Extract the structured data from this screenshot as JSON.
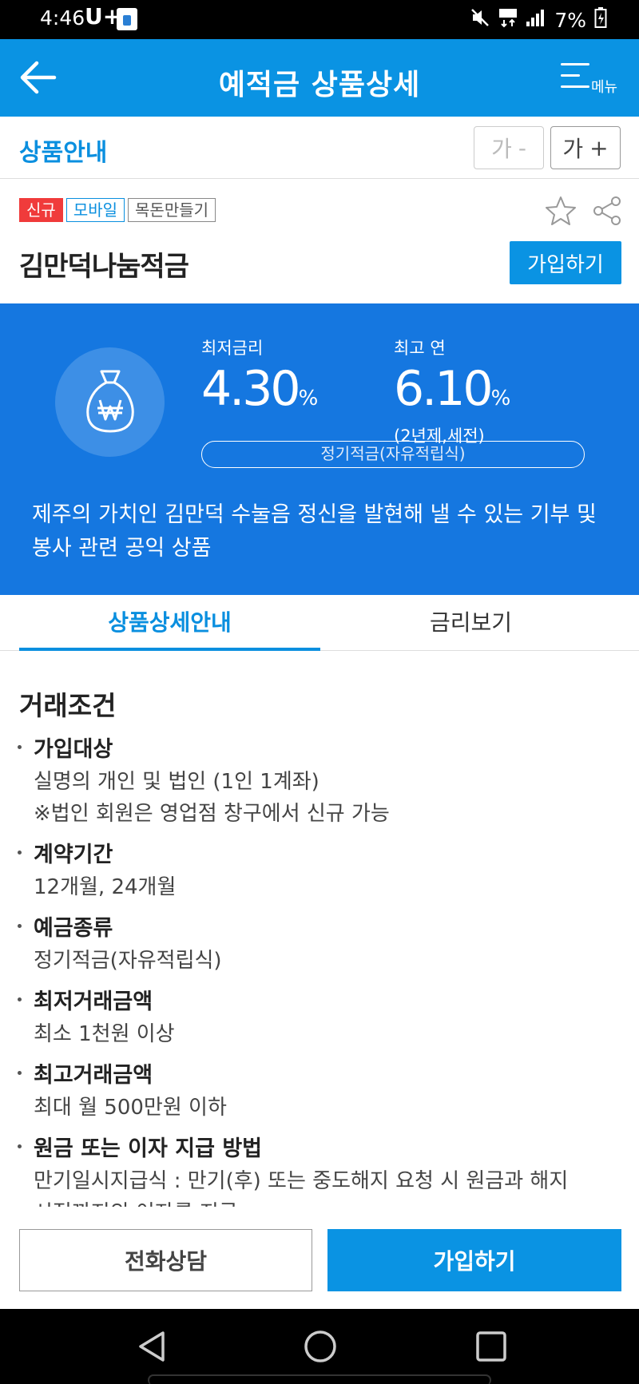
{
  "status_bar": {
    "time": "4:46",
    "carrier": "U+",
    "battery": "7%"
  },
  "header": {
    "title": "예적금 상품상세",
    "menu_label": "메뉴"
  },
  "info_bar": {
    "title": "상품안내",
    "font_minus": "가",
    "font_minus_sign": "-",
    "font_plus": "가",
    "font_plus_sign": "+"
  },
  "product": {
    "tags": [
      "신규",
      "모바일",
      "목돈만들기"
    ],
    "name": "김만덕나눔적금",
    "join_label": "가입하기",
    "min_rate_label": "최저금리",
    "min_rate": "4.30",
    "max_rate_label": "최고 연",
    "max_rate": "6.10",
    "percent": "%",
    "max_rate_note": "(2년제,세전)",
    "type": "정기적금(자유적립식)",
    "description": "제주의 가치인 김만덕 수눌음 정신을 발현해 낼 수 있는 기부 및 봉사 관련 공익 상품"
  },
  "tabs": [
    {
      "label": "상품상세안내",
      "active": true
    },
    {
      "label": "금리보기",
      "active": false
    }
  ],
  "details": {
    "section_title": "거래조건",
    "conditions": [
      {
        "label": "가입대상",
        "lines": [
          "실명의 개인 및 법인 (1인 1계좌)",
          "※법인 회원은 영업점 창구에서 신규 가능"
        ]
      },
      {
        "label": "계약기간",
        "lines": [
          "12개월, 24개월"
        ]
      },
      {
        "label": "예금종류",
        "lines": [
          "정기적금(자유적립식)"
        ]
      },
      {
        "label": "최저거래금액",
        "lines": [
          "최소 1천원 이상"
        ]
      },
      {
        "label": "최고거래금액",
        "lines": [
          "최대 월 500만원 이하"
        ]
      },
      {
        "label": "원금 또는 이자 지급 방법",
        "lines": [
          "만기일시지급식 : 만기(후) 또는 중도해지 요청 시 원금과 해지",
          "시점까지의 이자를 지급"
        ]
      }
    ]
  },
  "bottom_buttons": {
    "call": "전화상담",
    "join": "가입하기"
  },
  "colors": {
    "brand": "#0a93e3",
    "panel": "#1577e0",
    "tag_new": "#f03b3b"
  }
}
